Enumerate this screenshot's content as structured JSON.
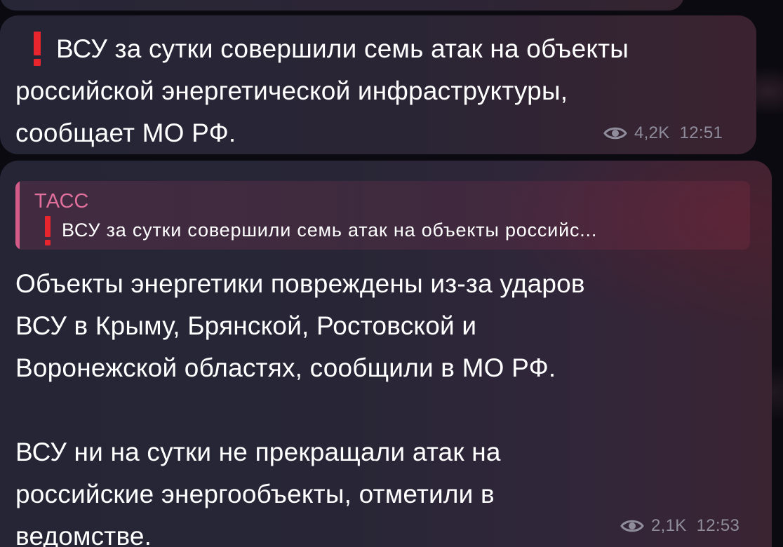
{
  "messages": [
    {
      "text": "ВСУ за сутки совершили семь атак на объекты\nроссийской энергетической инфраструктуры,\nсообщает МО РФ.",
      "views": "4,2K",
      "time": "12:51"
    },
    {
      "quote": {
        "source": "ТАСС",
        "text": "ВСУ за сутки совершили семь атак на объекты российс..."
      },
      "text": "Объекты энергетики повреждены из-за ударов\nВСУ в Крыму, Брянской, Ростовской и\nВоронежской областях, сообщили в МО РФ.\n\nВСУ ни на сутки не прекращали атак на\nроссийские энергообъекты, отметили в\nведомстве.",
      "views": "2,1K",
      "time": "12:53"
    }
  ],
  "colors": {
    "exclamation": "#e8242d",
    "quote_accent": "#d45a88",
    "meta": "#8f8d9c"
  },
  "icons": {
    "exclamation": "exclamation-icon",
    "views": "eye-icon"
  }
}
